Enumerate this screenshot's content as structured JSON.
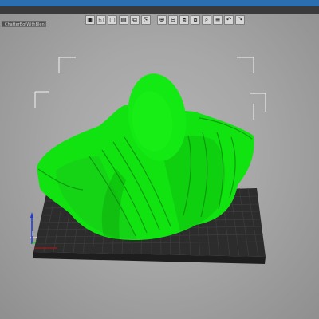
{
  "window": {
    "tab_title": "ChatterBotWithBlender"
  },
  "toolbar": {
    "buttons": [
      {
        "name": "add-object-icon",
        "glyph": "▣"
      },
      {
        "name": "add-shape-icon",
        "glyph": "◱"
      },
      {
        "name": "delete-icon",
        "glyph": "▢"
      },
      {
        "name": "delete-all-icon",
        "glyph": "▤"
      },
      {
        "name": "arrange-icon",
        "glyph": "⧉"
      },
      {
        "name": "copy-icon",
        "glyph": "⎘"
      },
      {
        "name": "add-instance-icon",
        "glyph": "⊕"
      },
      {
        "name": "remove-instance-icon",
        "glyph": "⊖"
      },
      {
        "name": "split-objects-icon",
        "glyph": "⧈"
      },
      {
        "name": "split-parts-icon",
        "glyph": "⧇"
      },
      {
        "name": "search-icon",
        "glyph": "⌕"
      },
      {
        "name": "layers-icon",
        "glyph": "≡"
      },
      {
        "name": "undo-icon",
        "glyph": "↶"
      },
      {
        "name": "redo-icon",
        "glyph": "↷"
      }
    ]
  },
  "colors": {
    "model_green": "#11e311",
    "bed_dark": "#2b2b2b",
    "bed_grid": "#3b3b3b",
    "bed_edge_red": "#b01818",
    "bounding_box": "#f3f3f3",
    "axis_blue": "#1836e0",
    "axis_green": "#22cc22"
  }
}
